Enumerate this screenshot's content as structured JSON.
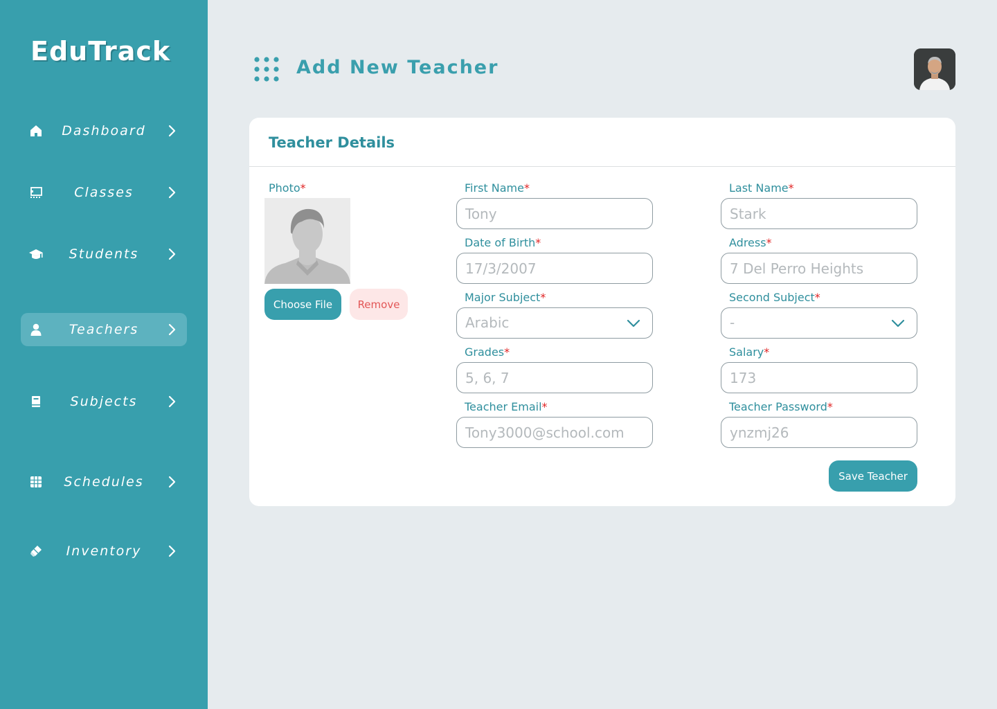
{
  "app": {
    "logo": "EduTrack"
  },
  "sidebar": {
    "items": [
      {
        "label": "Dashboard",
        "icon": "home-icon",
        "active": false
      },
      {
        "label": "Classes",
        "icon": "classroom-icon",
        "active": false
      },
      {
        "label": "Students",
        "icon": "graduation-cap-icon",
        "active": false
      },
      {
        "label": "Teachers",
        "icon": "person-icon",
        "active": true
      },
      {
        "label": "Subjects",
        "icon": "book-icon",
        "active": false
      },
      {
        "label": "Schedules",
        "icon": "calendar-grid-icon",
        "active": false
      },
      {
        "label": "Inventory",
        "icon": "eraser-icon",
        "active": false
      }
    ]
  },
  "header": {
    "title": "Add New Teacher",
    "menu_icon": "dots-grid-icon",
    "avatar": "user-avatar"
  },
  "card": {
    "title": "Teacher Details",
    "photo": {
      "label": "Photo",
      "choose_label": "Choose File",
      "remove_label": "Remove"
    },
    "fields": {
      "first_name": {
        "label": "First Name",
        "placeholder": "Tony"
      },
      "last_name": {
        "label": "Last Name",
        "placeholder": "Stark"
      },
      "dob": {
        "label": "Date of Birth",
        "placeholder": "17/3/2007"
      },
      "address": {
        "label": "Adress",
        "placeholder": "7 Del Perro Heights"
      },
      "major_subject": {
        "label": "Major Subject",
        "value": "Arabic"
      },
      "second_subject": {
        "label": "Second Subject",
        "value": "-"
      },
      "grades": {
        "label": "Grades",
        "placeholder": "5, 6, 7"
      },
      "salary": {
        "label": "Salary",
        "placeholder": "173"
      },
      "email": {
        "label": "Teacher Email",
        "placeholder": "Tony3000@school.com"
      },
      "password": {
        "label": "Teacher Password",
        "placeholder": "ynzmj26"
      }
    },
    "required_mark": "*",
    "save_label": "Save Teacher"
  },
  "colors": {
    "primary": "#389fad",
    "background": "#e6ebee",
    "danger": "#e02424",
    "remove_bg": "#fde7e7"
  }
}
